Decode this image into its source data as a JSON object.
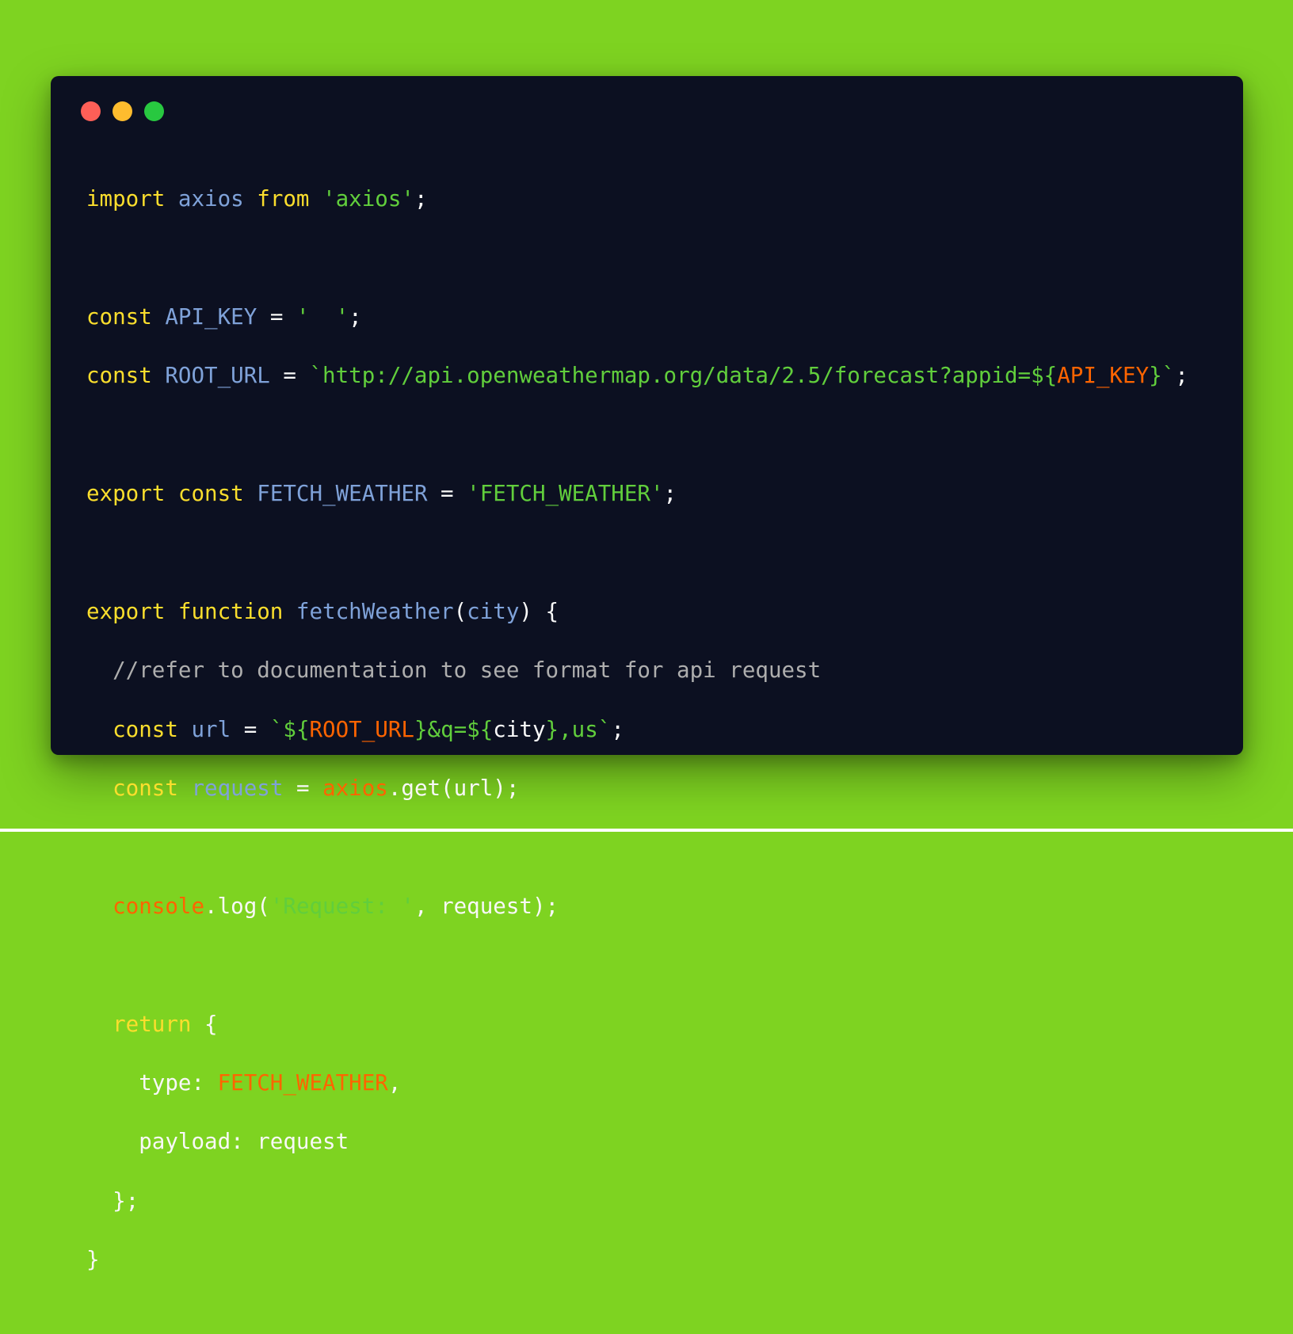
{
  "window": {
    "controls": [
      "close",
      "minimize",
      "zoom"
    ],
    "colors": {
      "close": "#fe5f57",
      "minimize": "#febc2e",
      "zoom": "#28c840",
      "background": "#0c1021",
      "page": "#7ed321"
    }
  },
  "code": {
    "line1": {
      "kw1": "import",
      "id": "axios",
      "kw2": "from",
      "str": "'axios'",
      "semi": ";"
    },
    "line3": {
      "kw": "const",
      "id": "API_KEY",
      "op": " = ",
      "str": "'  '",
      "semi": ";"
    },
    "line4": {
      "kw": "const",
      "id": "ROOT_URL",
      "op": " = ",
      "str1": "`http://api.openweathermap.org/data/2.5/forecast?appid=${",
      "var": "API_KEY",
      "str2": "}`",
      "semi": ";"
    },
    "line6": {
      "kw1": "export",
      "kw2": "const",
      "id": "FETCH_WEATHER",
      "op": " = ",
      "str": "'FETCH_WEATHER'",
      "semi": ";"
    },
    "line8": {
      "kw1": "export",
      "kw2": "function",
      "fn": "fetchWeather",
      "p1": "(",
      "param": "city",
      "p2": ") {"
    },
    "line9": {
      "cmt": "//refer to documentation to see format for api request"
    },
    "line10": {
      "kw": "const",
      "id": "url",
      "op": " = ",
      "s1": "`${",
      "var1": "ROOT_URL",
      "s2": "}&q=${",
      "inner": "city",
      "s3": "},us`",
      "semi": ";"
    },
    "line11": {
      "kw": "const",
      "id": "request",
      "op": " = ",
      "var": "axios",
      "rest": ".get(url);"
    },
    "line13": {
      "var": "console",
      "p1": ".log(",
      "str": "'Request: '",
      "p2": ", request);"
    },
    "line15": {
      "kw": "return",
      "rest": " {"
    },
    "line16": {
      "key": "type: ",
      "var": "FETCH_WEATHER",
      "comma": ","
    },
    "line17": {
      "key": "payload: ",
      "val": "request"
    },
    "line18": {
      "text": "};"
    },
    "line19": {
      "text": "}"
    }
  }
}
